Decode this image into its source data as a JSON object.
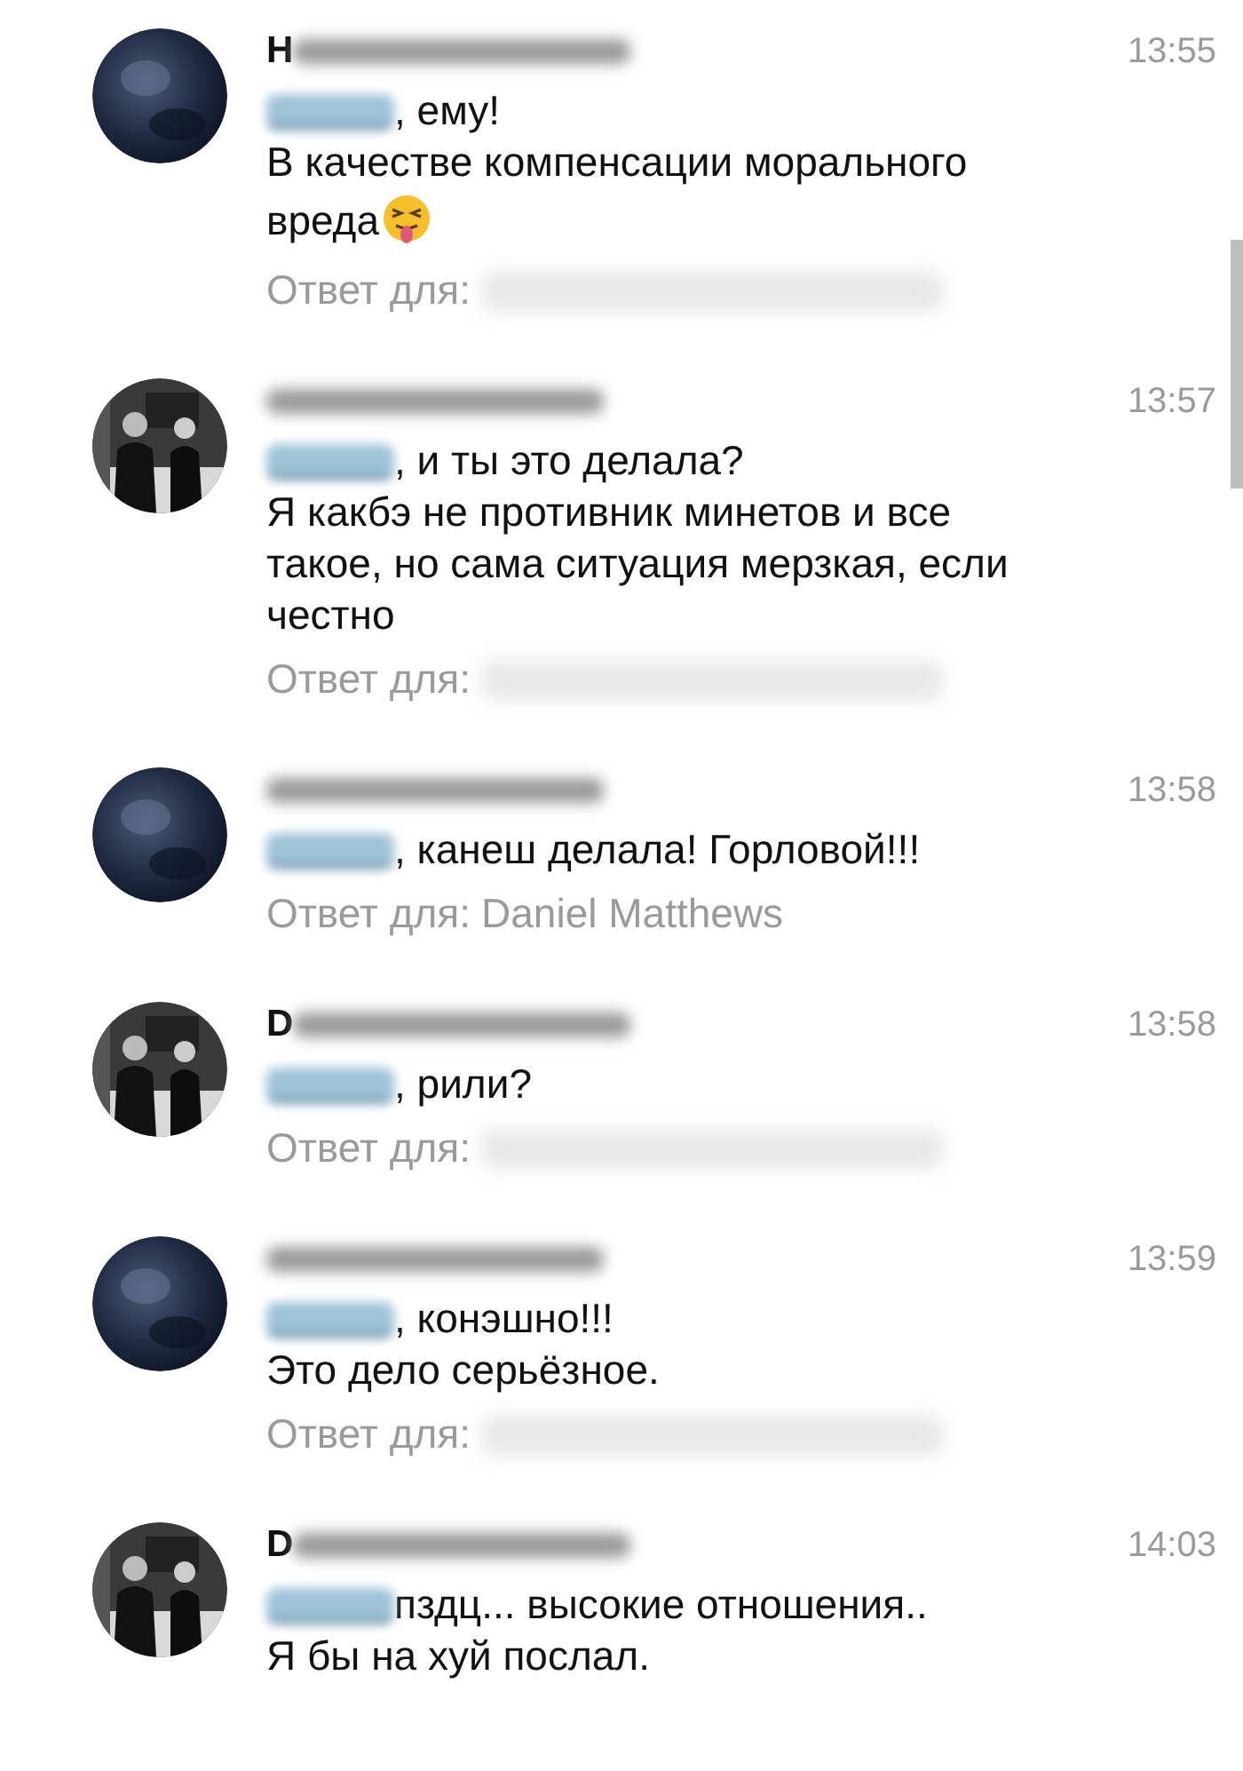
{
  "messages": [
    {
      "kind": "sphere",
      "name_initial": "Н",
      "time": "13:55",
      "first_line": ", ему!",
      "lines": [
        "В качестве компенсации морального",
        "вреда"
      ],
      "emoji": true,
      "reply": {
        "label": "Ответ для:"
      }
    },
    {
      "time": "13:57",
      "first_line": ", и ты это делала?",
      "lines": [
        "Я какбэ не противник минетов и все",
        "такое, но сама ситуация мерзкая, если",
        "честно"
      ],
      "reply": {
        "label": "Ответ для:"
      }
    },
    {
      "kind": "sphere",
      "time": "13:58",
      "first_line": ", канеш делала! Горловой!!!",
      "reply": {
        "label": "Ответ для:",
        "name": "Daniel Matthews"
      }
    },
    {
      "name_initial": "D",
      "time": "13:58",
      "first_line": ", рили?",
      "reply": {
        "label": "Ответ для:"
      }
    },
    {
      "kind": "sphere",
      "time": "13:59",
      "first_line": ", конэшно!!!",
      "lines": [
        "Это дело серьёзное."
      ],
      "reply": {
        "label": "Ответ для:"
      }
    },
    {
      "name_initial": "D",
      "time": "14:03",
      "first_line": " пздц... высокие отношения..",
      "lines": [
        "Я бы на хуй послал."
      ]
    }
  ]
}
